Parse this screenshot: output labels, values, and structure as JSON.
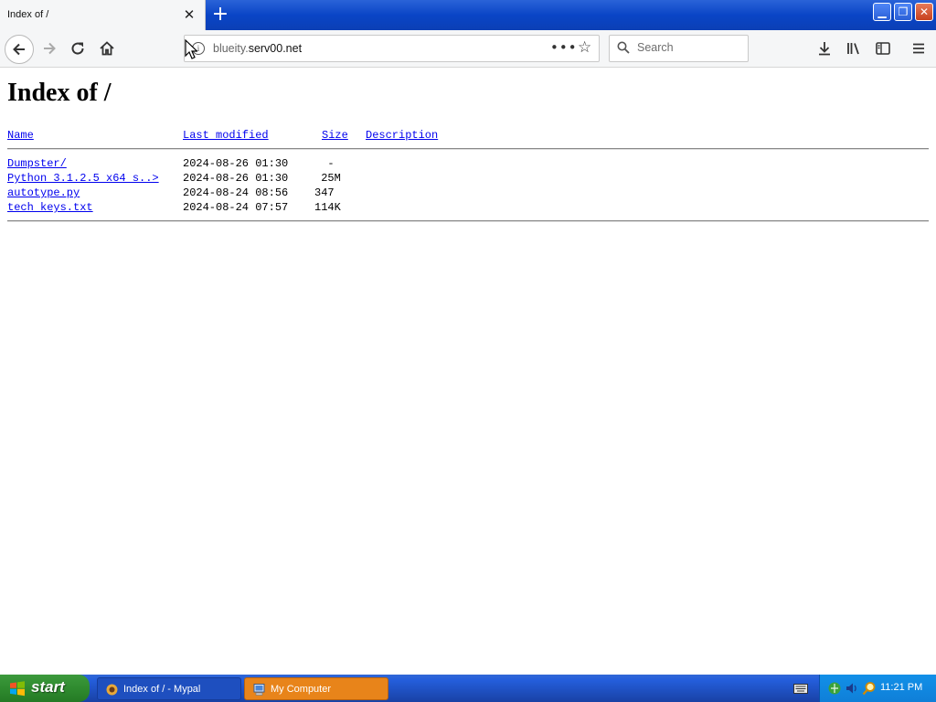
{
  "browser": {
    "tab_title": "Index of /",
    "tab_close": "✕",
    "new_tab": "+",
    "url_host_prefix": "blueity.",
    "url_host_main": "serv00.net",
    "search_placeholder": "Search",
    "page_actions": "•••"
  },
  "page": {
    "title": "Index of /",
    "columns": {
      "name": "Name",
      "last_modified": "Last modified",
      "size": "Size",
      "description": "Description"
    },
    "rows": [
      {
        "name": "Dumpster/",
        "modified": "2024-08-26 01:30",
        "size": "  -"
      },
      {
        "name": "Python 3.1.2.5 x64 s..>",
        "modified": "2024-08-26 01:30",
        "size": " 25M"
      },
      {
        "name": "autotype.py",
        "modified": "2024-08-24 08:56",
        "size": "347"
      },
      {
        "name": "tech keys.txt",
        "modified": "2024-08-24 07:57",
        "size": "114K"
      }
    ]
  },
  "taskbar": {
    "start_label": "start",
    "tasks": [
      {
        "label": "Index of / - Mypal"
      },
      {
        "label": "My Computer"
      }
    ],
    "clock": "11:21 PM"
  },
  "colors": {
    "link": "#0000ee",
    "taskbar_blue": "#245edb",
    "start_green": "#2f8b2f",
    "active_task_orange": "#e8841a"
  }
}
